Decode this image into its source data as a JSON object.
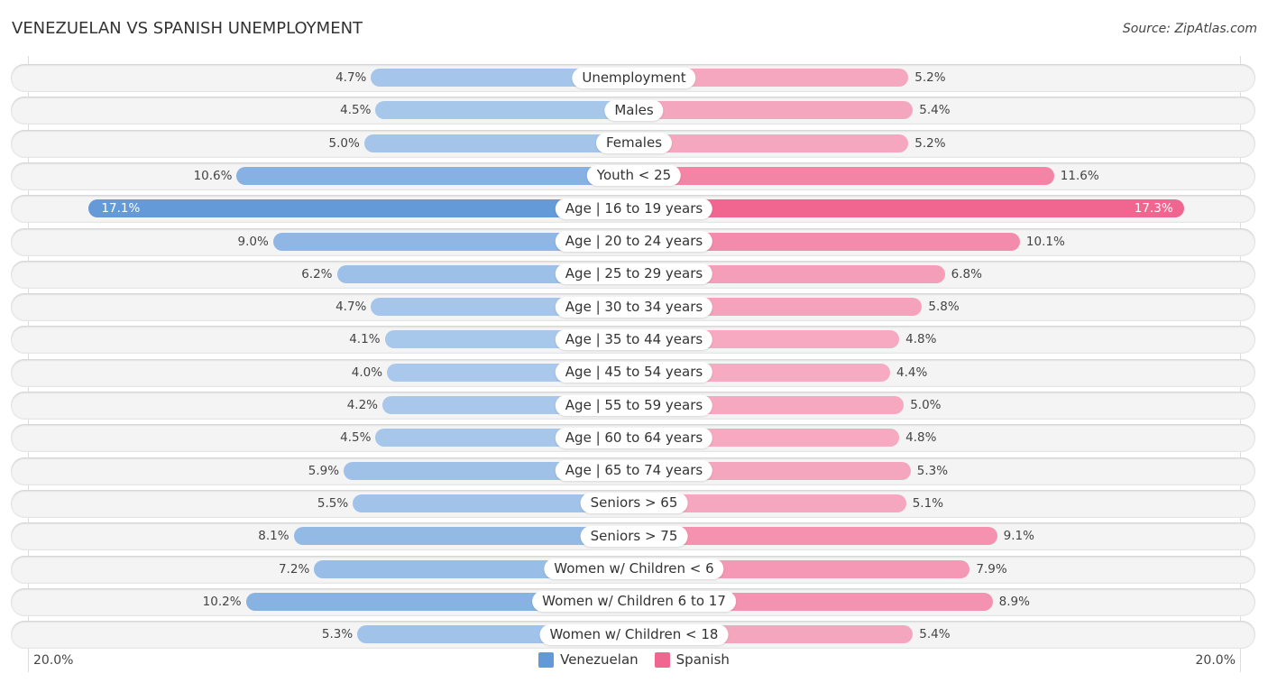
{
  "header": {
    "title": "VENEZUELAN VS SPANISH UNEMPLOYMENT",
    "source": "Source: ZipAtlas.com"
  },
  "chart_data": {
    "type": "bar",
    "orientation": "horizontal-diverging",
    "title": "VENEZUELAN VS SPANISH UNEMPLOYMENT",
    "categories": [
      "Unemployment",
      "Males",
      "Females",
      "Youth < 25",
      "Age | 16 to 19 years",
      "Age | 20 to 24 years",
      "Age | 25 to 29 years",
      "Age | 30 to 34 years",
      "Age | 35 to 44 years",
      "Age | 45 to 54 years",
      "Age | 55 to 59 years",
      "Age | 60 to 64 years",
      "Age | 65 to 74 years",
      "Seniors > 65",
      "Seniors > 75",
      "Women w/ Children < 6",
      "Women w/ Children 6 to 17",
      "Women w/ Children < 18"
    ],
    "series": [
      {
        "name": "Venezuelan",
        "color": "#6399d8",
        "side": "left",
        "values": [
          4.7,
          4.5,
          5.0,
          10.6,
          17.1,
          9.0,
          6.2,
          4.7,
          4.1,
          4.0,
          4.2,
          4.5,
          5.9,
          5.5,
          8.1,
          7.2,
          10.2,
          5.3
        ]
      },
      {
        "name": "Spanish",
        "color": "#f06690",
        "side": "right",
        "values": [
          5.2,
          5.4,
          5.2,
          11.6,
          17.3,
          10.1,
          6.8,
          5.8,
          4.8,
          4.4,
          5.0,
          4.8,
          5.3,
          5.1,
          9.1,
          7.9,
          8.9,
          5.4
        ]
      }
    ],
    "value_format": "{v}%",
    "axis": {
      "left_label": "20.0%",
      "right_label": "20.0%",
      "max": 20.0
    },
    "legend": {
      "position": "bottom-center",
      "entries": [
        "Venezuelan",
        "Spanish"
      ]
    },
    "grid": false
  },
  "colors": {
    "venezuelan_light": "#a9c8eb",
    "venezuelan_strong": "#6399d8",
    "spanish_light": "#f6adc4",
    "spanish_strong": "#f06690"
  }
}
